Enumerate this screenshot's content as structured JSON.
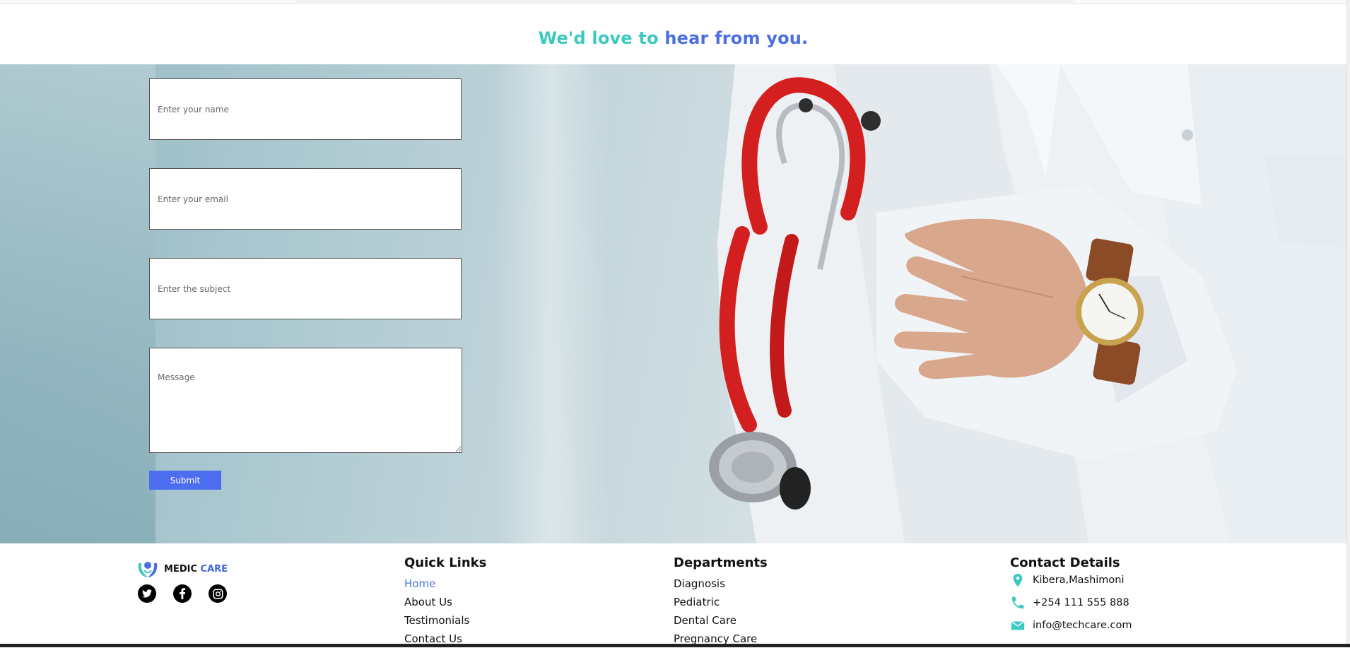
{
  "heading": {
    "part1": "We'd love to",
    "part2": "hear from you."
  },
  "form": {
    "name_placeholder": "Enter your name",
    "email_placeholder": "Enter your email",
    "subject_placeholder": "Enter the subject",
    "message_placeholder": "Message",
    "submit_label": "Submit"
  },
  "footer": {
    "brand": {
      "part1": "MEDIC",
      "part2": "CARE"
    },
    "socials": [
      "twitter-icon",
      "facebook-icon",
      "instagram-icon"
    ],
    "quick_links": {
      "title": "Quick Links",
      "items": [
        "Home",
        "About Us",
        "Testimonials",
        "Contact Us"
      ]
    },
    "departments": {
      "title": "Departments",
      "items": [
        "Diagnosis",
        "Pediatric",
        "Dental Care",
        "Pregnancy Care"
      ]
    },
    "contact": {
      "title": "Contact Details",
      "address": "Kibera,Mashimoni",
      "phone": "+254 111 555 888",
      "email": "info@techcare.com"
    }
  },
  "colors": {
    "accent_teal": "#3cc9c0",
    "accent_blue": "#4c6fe0",
    "button": "#4d6df0"
  }
}
